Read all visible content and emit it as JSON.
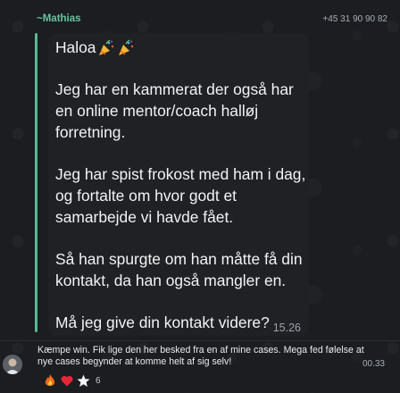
{
  "header": {
    "sender_name": "~Mathias",
    "phone": "+45 31 90 90 82"
  },
  "quoted_message": {
    "greeting": "Haloa",
    "greeting_icons": [
      "party-popper-icon",
      "party-popper-icon"
    ],
    "paragraphs": [
      "Jeg har en kammerat der også har en online mentor/coach halløj forretning.",
      "Jeg har spist frokost med ham i dag, og fortalte om hvor godt et samarbejde vi havde fået.",
      "Så han spurgte om han måtte få din kontakt, da han også mangler en.",
      "Må jeg give din kontakt videre?"
    ],
    "time": "15.26"
  },
  "caption": {
    "text": "Kæmpe win. Fik lige den her besked fra en af mine cases. Mega fed følelse at nye cases begynder at komme helt af sig selv!",
    "time": "00.33"
  },
  "reactions": {
    "icons": [
      "fire-icon",
      "heart-icon",
      "star-icon"
    ],
    "count": "6"
  },
  "colors": {
    "sender": "#63c3a0",
    "accent_bar": "#59b994",
    "bubble": "#1f2124",
    "background": "#1b1d20"
  }
}
